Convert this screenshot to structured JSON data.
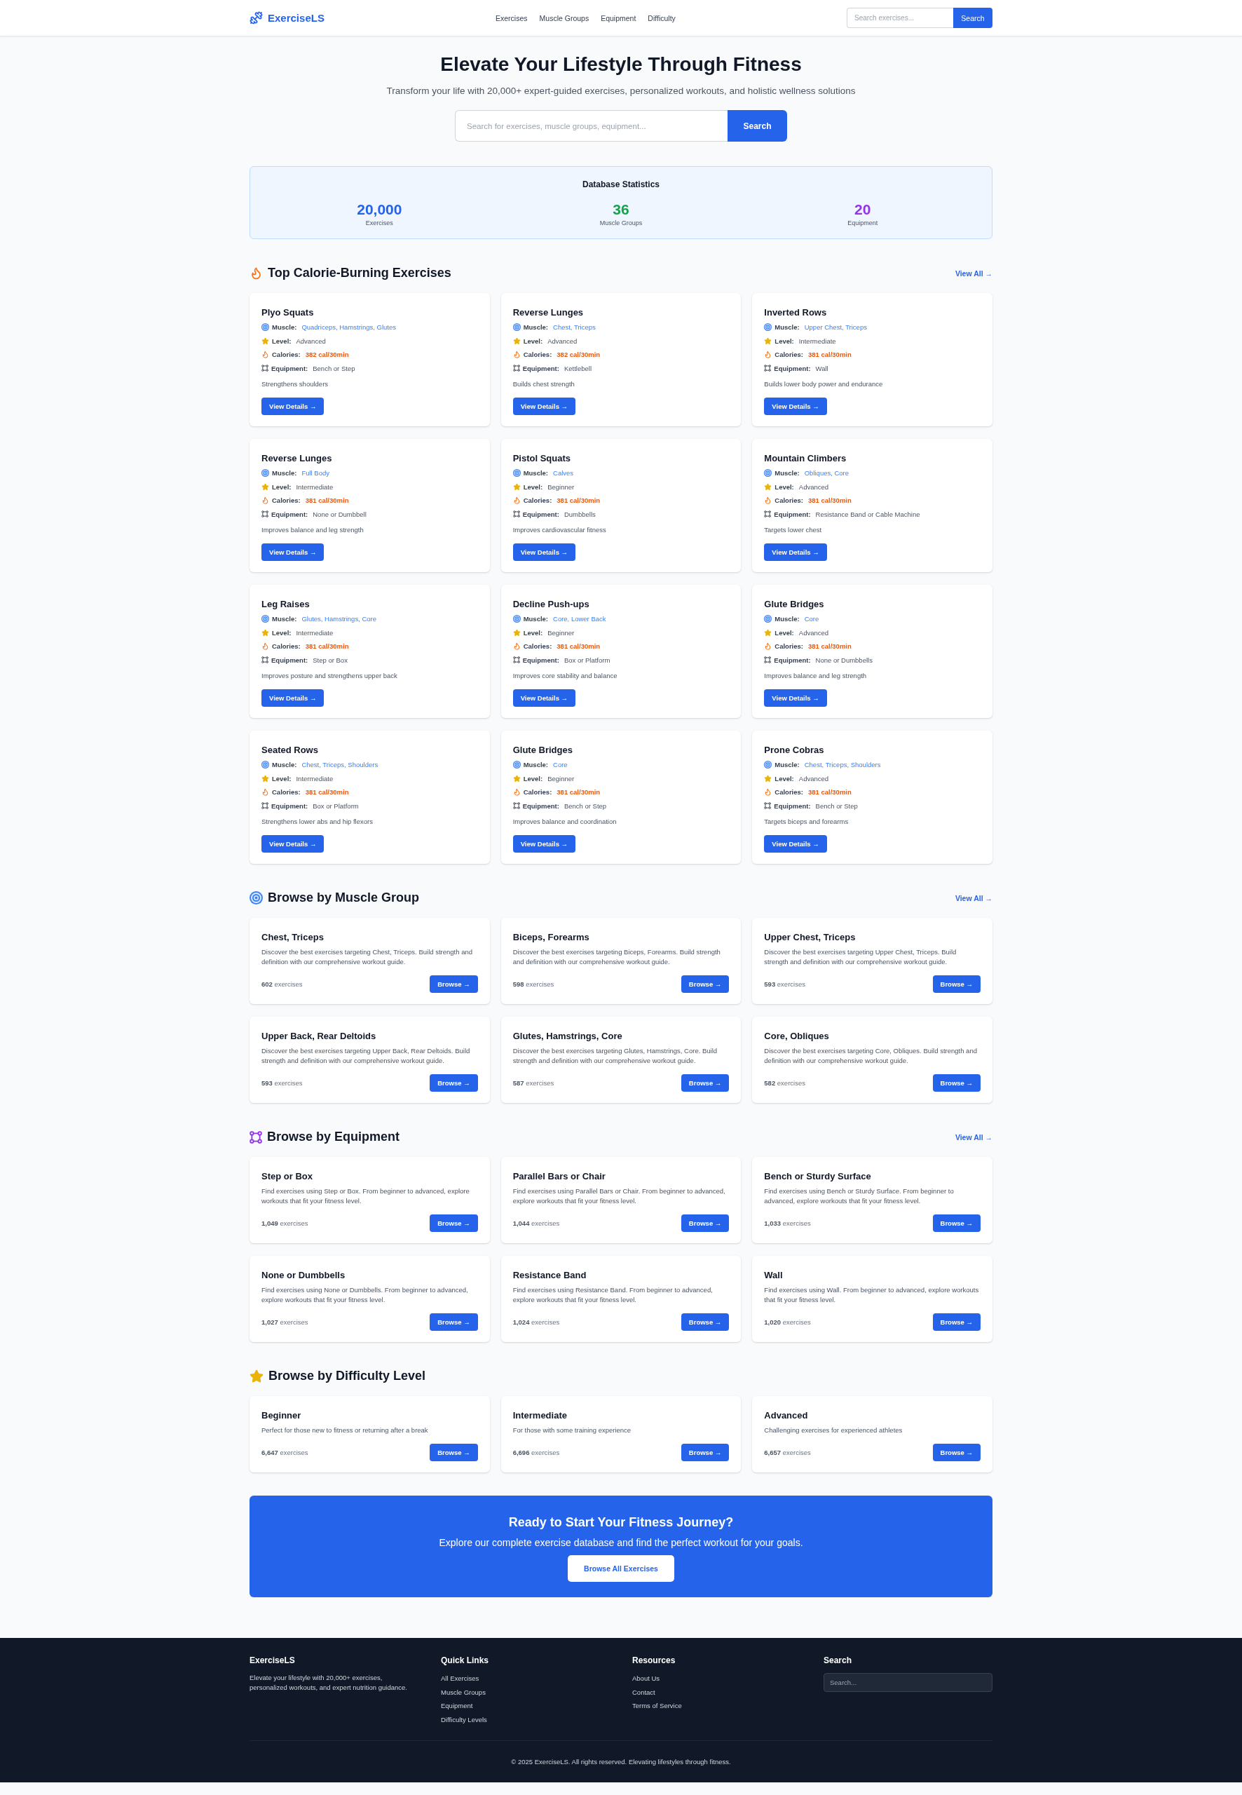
{
  "header": {
    "logo": "ExerciseLS",
    "nav": [
      "Exercises",
      "Muscle Groups",
      "Equipment",
      "Difficulty"
    ],
    "search": {
      "placeholder": "Search exercises...",
      "button": "Search"
    }
  },
  "hero": {
    "title": "Elevate Your Lifestyle Through Fitness",
    "subtitle": "Transform your life with 20,000+ expert-guided exercises, personalized workouts, and holistic wellness solutions",
    "search": {
      "placeholder": "Search for exercises, muscle groups, equipment...",
      "button": "Search"
    }
  },
  "stats": {
    "title": "Database Statistics",
    "items": [
      {
        "value": "20,000",
        "label": "Exercises",
        "color": "#2563eb"
      },
      {
        "value": "36",
        "label": "Muscle Groups",
        "color": "#16a34a"
      },
      {
        "value": "20",
        "label": "Equipment",
        "color": "#9333ea"
      }
    ]
  },
  "top_exercises": {
    "title": "Top Calorie-Burning Exercises",
    "link": "View All →",
    "cards": [
      {
        "name": "Plyo Squats",
        "fields": [
          {
            "kind": "muscle",
            "label": "Muscle:",
            "value": "Quadriceps, Hamstrings, Glutes"
          },
          {
            "kind": "level",
            "label": "Level:",
            "value": "Advanced"
          },
          {
            "kind": "calories",
            "label": "Calories:",
            "value": "382 cal/30min"
          },
          {
            "kind": "equipment",
            "label": "Equipment:",
            "value": "Bench or Step"
          }
        ],
        "description": "Strengthens shoulders",
        "button": "View Details →"
      },
      {
        "name": "Reverse Lunges",
        "fields": [
          {
            "kind": "muscle",
            "label": "Muscle:",
            "value": "Chest, Triceps"
          },
          {
            "kind": "level",
            "label": "Level:",
            "value": "Advanced"
          },
          {
            "kind": "calories",
            "label": "Calories:",
            "value": "382 cal/30min"
          },
          {
            "kind": "equipment",
            "label": "Equipment:",
            "value": "Kettlebell"
          }
        ],
        "description": "Builds chest strength",
        "button": "View Details →"
      },
      {
        "name": "Inverted Rows",
        "fields": [
          {
            "kind": "muscle",
            "label": "Muscle:",
            "value": "Upper Chest, Triceps"
          },
          {
            "kind": "level",
            "label": "Level:",
            "value": "Intermediate"
          },
          {
            "kind": "calories",
            "label": "Calories:",
            "value": "381 cal/30min"
          },
          {
            "kind": "equipment",
            "label": "Equipment:",
            "value": "Wall"
          }
        ],
        "description": "Builds lower body power and endurance",
        "button": "View Details →"
      },
      {
        "name": "Reverse Lunges",
        "fields": [
          {
            "kind": "muscle",
            "label": "Muscle:",
            "value": "Full Body"
          },
          {
            "kind": "level",
            "label": "Level:",
            "value": "Intermediate"
          },
          {
            "kind": "calories",
            "label": "Calories:",
            "value": "381 cal/30min"
          },
          {
            "kind": "equipment",
            "label": "Equipment:",
            "value": "None or Dumbbell"
          }
        ],
        "description": "Improves balance and leg strength",
        "button": "View Details →"
      },
      {
        "name": "Pistol Squats",
        "fields": [
          {
            "kind": "muscle",
            "label": "Muscle:",
            "value": "Calves"
          },
          {
            "kind": "level",
            "label": "Level:",
            "value": "Beginner"
          },
          {
            "kind": "calories",
            "label": "Calories:",
            "value": "381 cal/30min"
          },
          {
            "kind": "equipment",
            "label": "Equipment:",
            "value": "Dumbbells"
          }
        ],
        "description": "Improves cardiovascular fitness",
        "button": "View Details →"
      },
      {
        "name": "Mountain Climbers",
        "fields": [
          {
            "kind": "muscle",
            "label": "Muscle:",
            "value": "Obliques, Core"
          },
          {
            "kind": "level",
            "label": "Level:",
            "value": "Advanced"
          },
          {
            "kind": "calories",
            "label": "Calories:",
            "value": "381 cal/30min"
          },
          {
            "kind": "equipment",
            "label": "Equipment:",
            "value": "Resistance Band or Cable Machine"
          }
        ],
        "description": "Targets lower chest",
        "button": "View Details →"
      },
      {
        "name": "Leg Raises",
        "fields": [
          {
            "kind": "muscle",
            "label": "Muscle:",
            "value": "Glutes, Hamstrings, Core"
          },
          {
            "kind": "level",
            "label": "Level:",
            "value": "Intermediate"
          },
          {
            "kind": "calories",
            "label": "Calories:",
            "value": "381 cal/30min"
          },
          {
            "kind": "equipment",
            "label": "Equipment:",
            "value": "Step or Box"
          }
        ],
        "description": "Improves posture and strengthens upper back",
        "button": "View Details →"
      },
      {
        "name": "Decline Push-ups",
        "fields": [
          {
            "kind": "muscle",
            "label": "Muscle:",
            "value": "Core, Lower Back"
          },
          {
            "kind": "level",
            "label": "Level:",
            "value": "Beginner"
          },
          {
            "kind": "calories",
            "label": "Calories:",
            "value": "381 cal/30min"
          },
          {
            "kind": "equipment",
            "label": "Equipment:",
            "value": "Box or Platform"
          }
        ],
        "description": "Improves core stability and balance",
        "button": "View Details →"
      },
      {
        "name": "Glute Bridges",
        "fields": [
          {
            "kind": "muscle",
            "label": "Muscle:",
            "value": "Core"
          },
          {
            "kind": "level",
            "label": "Level:",
            "value": "Advanced"
          },
          {
            "kind": "calories",
            "label": "Calories:",
            "value": "381 cal/30min"
          },
          {
            "kind": "equipment",
            "label": "Equipment:",
            "value": "None or Dumbbells"
          }
        ],
        "description": "Improves balance and leg strength",
        "button": "View Details →"
      },
      {
        "name": "Seated Rows",
        "fields": [
          {
            "kind": "muscle",
            "label": "Muscle:",
            "value": "Chest, Triceps, Shoulders"
          },
          {
            "kind": "level",
            "label": "Level:",
            "value": "Intermediate"
          },
          {
            "kind": "calories",
            "label": "Calories:",
            "value": "381 cal/30min"
          },
          {
            "kind": "equipment",
            "label": "Equipment:",
            "value": "Box or Platform"
          }
        ],
        "description": "Strengthens lower abs and hip flexors",
        "button": "View Details →"
      },
      {
        "name": "Glute Bridges",
        "fields": [
          {
            "kind": "muscle",
            "label": "Muscle:",
            "value": "Core"
          },
          {
            "kind": "level",
            "label": "Level:",
            "value": "Beginner"
          },
          {
            "kind": "calories",
            "label": "Calories:",
            "value": "381 cal/30min"
          },
          {
            "kind": "equipment",
            "label": "Equipment:",
            "value": "Bench or Step"
          }
        ],
        "description": "Improves balance and coordination",
        "button": "View Details →"
      },
      {
        "name": "Prone Cobras",
        "fields": [
          {
            "kind": "muscle",
            "label": "Muscle:",
            "value": "Chest, Triceps, Shoulders"
          },
          {
            "kind": "level",
            "label": "Level:",
            "value": "Advanced"
          },
          {
            "kind": "calories",
            "label": "Calories:",
            "value": "381 cal/30min"
          },
          {
            "kind": "equipment",
            "label": "Equipment:",
            "value": "Bench or Step"
          }
        ],
        "description": "Targets biceps and forearms",
        "button": "View Details →"
      }
    ]
  },
  "muscle_groups": {
    "title": "Browse by Muscle Group",
    "link": "View All →",
    "cards": [
      {
        "title": "Chest, Triceps",
        "description": "Discover the best exercises targeting Chest, Triceps. Build strength and definition with our comprehensive workout guide.",
        "count": "**602** exercises",
        "button": "Browse →"
      },
      {
        "title": "Biceps, Forearms",
        "description": "Discover the best exercises targeting Biceps, Forearms. Build strength and definition with our comprehensive workout guide.",
        "count": "**598** exercises",
        "button": "Browse →"
      },
      {
        "title": "Upper Chest, Triceps",
        "description": "Discover the best exercises targeting Upper Chest, Triceps. Build strength and definition with our comprehensive workout guide.",
        "count": "**593** exercises",
        "button": "Browse →"
      },
      {
        "title": "Upper Back, Rear Deltoids",
        "description": "Discover the best exercises targeting Upper Back, Rear Deltoids. Build strength and definition with our comprehensive workout guide.",
        "count": "**593** exercises",
        "button": "Browse →"
      },
      {
        "title": "Glutes, Hamstrings, Core",
        "description": "Discover the best exercises targeting Glutes, Hamstrings, Core. Build strength and definition with our comprehensive workout guide.",
        "count": "**587** exercises",
        "button": "Browse →"
      },
      {
        "title": "Core, Obliques",
        "description": "Discover the best exercises targeting Core, Obliques. Build strength and definition with our comprehensive workout guide.",
        "count": "**582** exercises",
        "button": "Browse →"
      }
    ]
  },
  "equipment": {
    "title": "Browse by Equipment",
    "link": "View All →",
    "cards": [
      {
        "title": "Step or Box",
        "description": "Find exercises using Step or Box. From beginner to advanced, explore workouts that fit your fitness level.",
        "count": "**1,049** exercises",
        "button": "Browse →"
      },
      {
        "title": "Parallel Bars or Chair",
        "description": "Find exercises using Parallel Bars or Chair. From beginner to advanced, explore workouts that fit your fitness level.",
        "count": "**1,044** exercises",
        "button": "Browse →"
      },
      {
        "title": "Bench or Sturdy Surface",
        "description": "Find exercises using Bench or Sturdy Surface. From beginner to advanced, explore workouts that fit your fitness level.",
        "count": "**1,033** exercises",
        "button": "Browse →"
      },
      {
        "title": "None or Dumbbells",
        "description": "Find exercises using None or Dumbbells. From beginner to advanced, explore workouts that fit your fitness level.",
        "count": "**1,027** exercises",
        "button": "Browse →"
      },
      {
        "title": "Resistance Band",
        "description": "Find exercises using Resistance Band. From beginner to advanced, explore workouts that fit your fitness level.",
        "count": "**1,024** exercises",
        "button": "Browse →"
      },
      {
        "title": "Wall",
        "description": "Find exercises using Wall. From beginner to advanced, explore workouts that fit your fitness level.",
        "count": "**1,020** exercises",
        "button": "Browse →"
      }
    ]
  },
  "difficulty": {
    "title": "Browse by Difficulty Level",
    "cards": [
      {
        "title": "Beginner",
        "description": "Perfect for those new to fitness or returning after a break",
        "count": "**6,647** exercises",
        "button": "Browse →"
      },
      {
        "title": "Intermediate",
        "description": "For those with some training experience",
        "count": "**6,696** exercises",
        "button": "Browse →"
      },
      {
        "title": "Advanced",
        "description": "Challenging exercises for experienced athletes",
        "count": "**6,657** exercises",
        "button": "Browse →"
      }
    ]
  },
  "cta": {
    "title": "Ready to Start Your Fitness Journey?",
    "text": "Explore our complete exercise database and find the perfect workout for your goals.",
    "button": "Browse All Exercises"
  },
  "footer": {
    "brand": {
      "title": "ExerciseLS",
      "text": "Elevate your lifestyle with 20,000+ exercises, personalized workouts, and expert nutrition guidance."
    },
    "columns": [
      {
        "title": "Quick Links",
        "links": [
          "All Exercises",
          "Muscle Groups",
          "Equipment",
          "Difficulty Levels"
        ]
      },
      {
        "title": "Resources",
        "links": [
          "About Us",
          "Contact",
          "Terms of Service"
        ]
      }
    ],
    "search": {
      "title": "Search",
      "placeholder": "Search..."
    },
    "copyright": "© 2025 ExerciseLS. All rights reserved. Elevating lifestyles through fitness."
  }
}
